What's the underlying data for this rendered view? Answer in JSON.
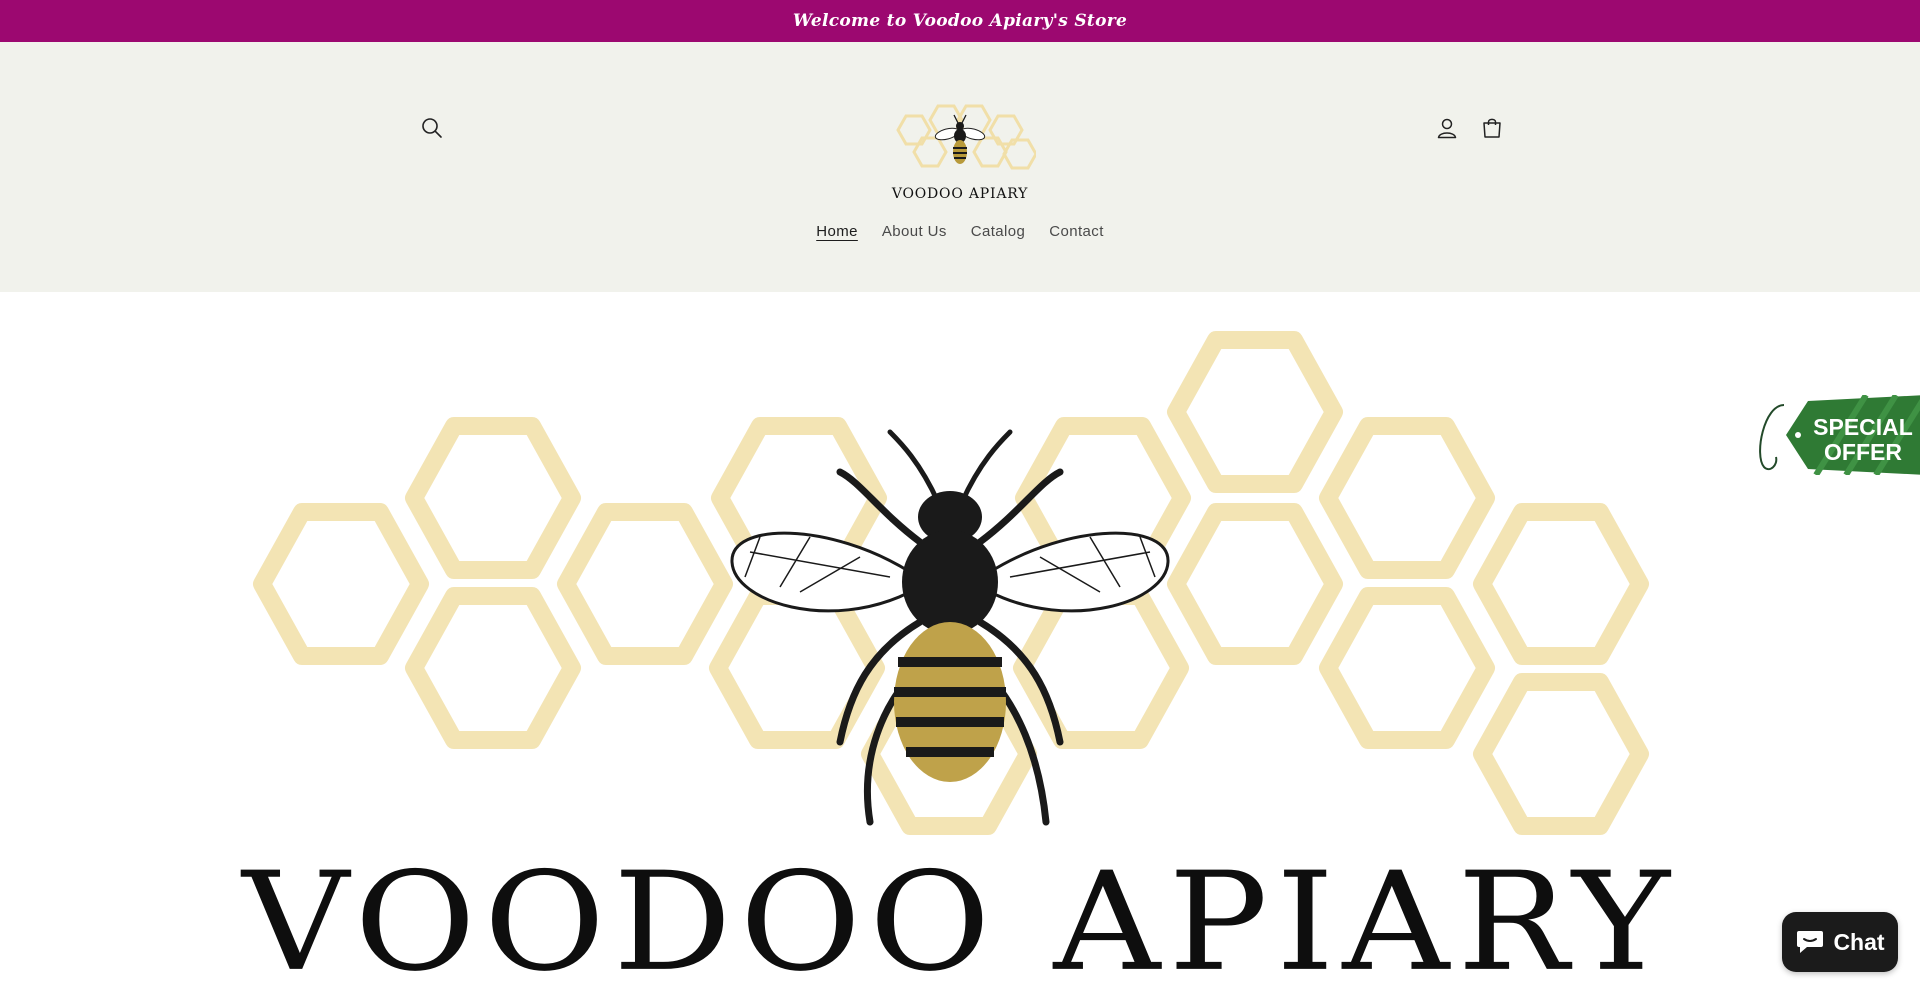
{
  "announcement": {
    "text": "Welcome to Voodoo Apiary's Store"
  },
  "header": {
    "logo_text": "VOODOO APIARY",
    "search_icon": "search-icon",
    "account_icon": "account-icon",
    "cart_icon": "cart-icon"
  },
  "nav": {
    "items": [
      {
        "label": "Home",
        "active": true
      },
      {
        "label": "About Us",
        "active": false
      },
      {
        "label": "Catalog",
        "active": false
      },
      {
        "label": "Contact",
        "active": false
      }
    ]
  },
  "hero": {
    "title": "VOODOO APIARY"
  },
  "offer": {
    "line1": "SPECIAL",
    "line2": "OFFER"
  },
  "chat": {
    "label": "Chat",
    "icon": "chat-bubble-icon"
  },
  "colors": {
    "announcement_bg": "#9c0870",
    "header_bg": "#f1f2ec",
    "honeycomb": "#f3e4b4",
    "offer_green": "#2f7a34",
    "chat_bg": "#1b1b1b"
  }
}
